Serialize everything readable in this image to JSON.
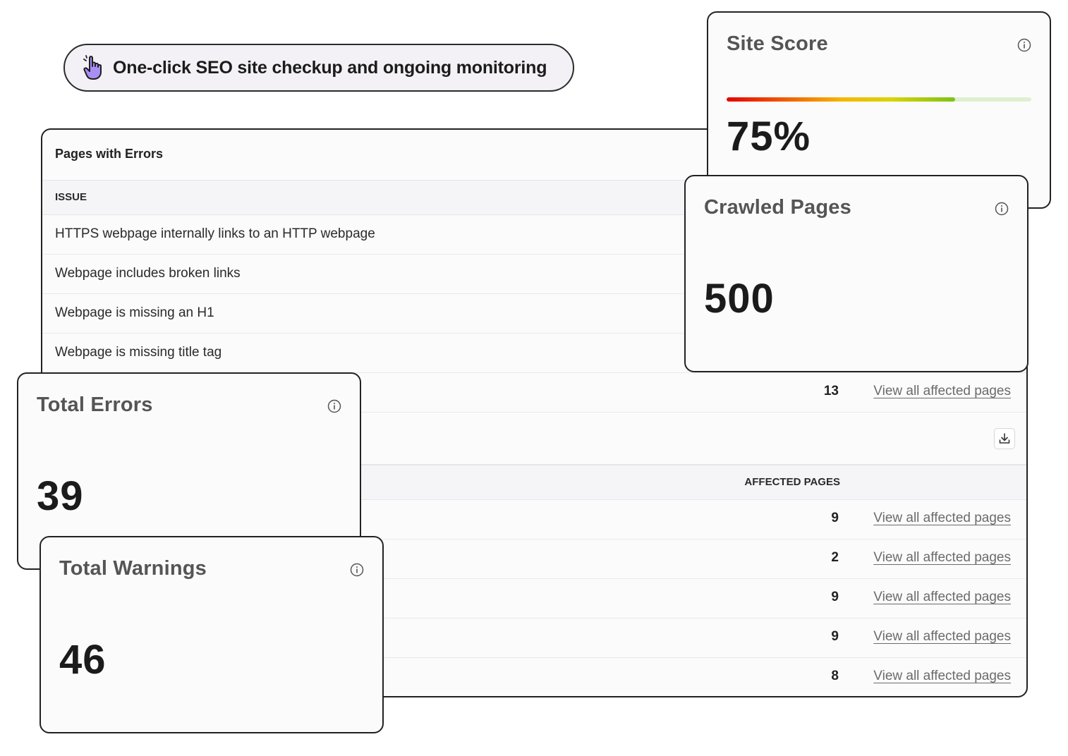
{
  "banner": {
    "text": "One-click SEO site checkup and ongoing monitoring",
    "icon": "pointer-hand-icon"
  },
  "errors_panel": {
    "title": "Pages with Errors",
    "column_issue": "ISSUE",
    "rows": [
      {
        "issue": "HTTPS webpage internally links to an HTTP webpage"
      },
      {
        "issue": "Webpage includes broken links"
      },
      {
        "issue": "Webpage is missing an H1"
      },
      {
        "issue": "Webpage is missing title tag"
      },
      {
        "count": "13",
        "link": "View all affected pages"
      }
    ]
  },
  "warnings_panel": {
    "column_affected": "AFFECTED PAGES",
    "download_icon": "download-icon",
    "rows": [
      {
        "count": "9",
        "link": "View all affected pages"
      },
      {
        "count": "2",
        "link": "View all affected pages"
      },
      {
        "count": "9",
        "link": "View all affected pages"
      },
      {
        "count": "9",
        "link": "View all affected pages"
      },
      {
        "count": "8",
        "link": "View all affected pages"
      }
    ]
  },
  "site_score": {
    "title": "Site Score",
    "value": "75%",
    "progress": 0.75,
    "info_icon": "info-icon"
  },
  "crawled_pages": {
    "title": "Crawled Pages",
    "value": "500",
    "info_icon": "info-icon"
  },
  "total_errors": {
    "title": "Total Errors",
    "value": "39",
    "info_icon": "info-icon"
  },
  "total_warnings": {
    "title": "Total Warnings",
    "value": "46",
    "info_icon": "info-icon"
  },
  "colors": {
    "accent_purple": "#9b7ef0",
    "score_bar_track": "#dff0cf"
  }
}
